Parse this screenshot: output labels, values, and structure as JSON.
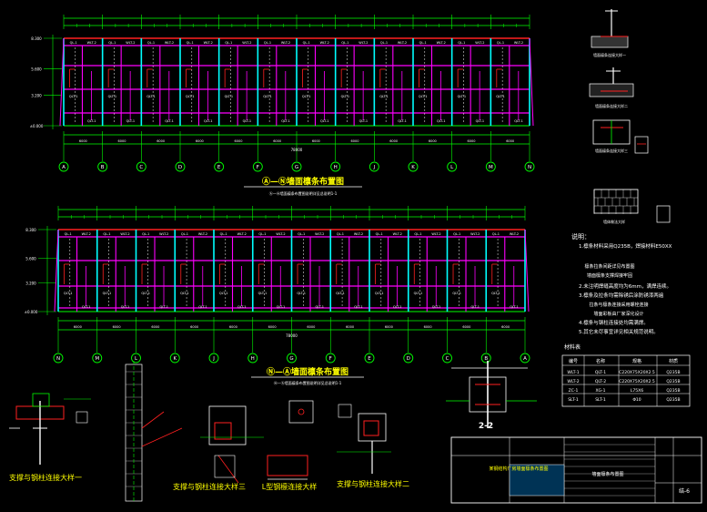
{
  "plans": [
    {
      "title": "Ⓐ—Ⓝ墙面檩条布置图",
      "axes": [
        "A",
        "B",
        "C",
        "D",
        "E",
        "F",
        "G",
        "H",
        "J",
        "K",
        "L",
        "M",
        "N"
      ]
    },
    {
      "title": "Ⓝ—Ⓐ墙面檩条布置图",
      "axes": [
        "N",
        "M",
        "L",
        "K",
        "J",
        "H",
        "G",
        "F",
        "E",
        "D",
        "C",
        "B",
        "A"
      ]
    }
  ],
  "details": {
    "detail1": "支撑与钢柱连接大样一",
    "detail2": "支撑与钢柱连接大样三",
    "detail3": "L型钢檩连接大样",
    "detail4": "支撑与钢柱连接大样二",
    "section": "2-2"
  },
  "notes": {
    "heading": "说明：",
    "items": [
      "1.檩条材料采用Q235B，焊接材料E50XX",
      "2.未注明焊缝高度均为6mm，满焊连续。",
      "3.檩条及拉条均需除锈后涂防锈漆两遍",
      "4.檩条与钢柱连接处均需满焊。",
      "5.其它未尽事宜详见相关规范说明。"
    ]
  },
  "table": {
    "title": "材料表",
    "headers": [
      "编号",
      "名称",
      "规格",
      "材质"
    ],
    "rows": [
      [
        "WLT-1",
        "QLT-1",
        "C220X75X20X2.5",
        "Q235B"
      ],
      [
        "WLT-2",
        "QLT-2",
        "C220X75X20X2.5",
        "Q235B"
      ],
      [
        "ZC-1",
        "XG-1",
        "L75X6",
        "Q235B"
      ],
      [
        "SLT-1",
        "SLT-1",
        "Φ10",
        "Q235B"
      ]
    ]
  },
  "titleblock": {
    "project": "某钢结构厂房墙面檩条布置图",
    "drawing": "墙面檩条布置图",
    "sheet": "结-6"
  },
  "colors": {
    "bg": "#000000",
    "grid": "#00ff00",
    "column": "#00ffff",
    "girt": "#ff00ff",
    "brace": "#ff2020",
    "dim": "#ffffff",
    "text": "#ffff00"
  }
}
